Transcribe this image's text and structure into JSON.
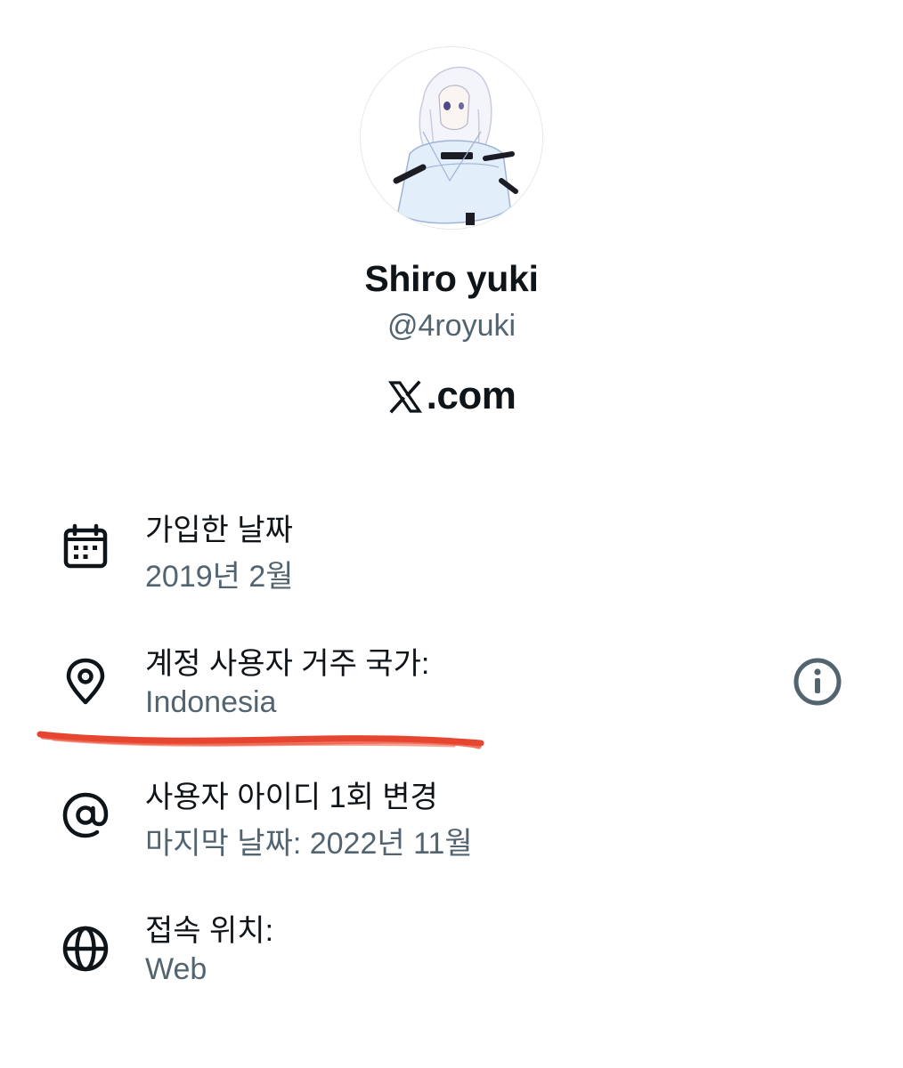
{
  "profile": {
    "display_name": "Shiro yuki",
    "handle": "@4royuki",
    "brand": ".com"
  },
  "about": {
    "joined": {
      "icon": "calendar-icon",
      "title": "가입한 날짜",
      "value": "2019년 2월"
    },
    "country": {
      "icon": "location-pin-icon",
      "title": "계정 사용자 거주 국가:",
      "value": "Indonesia",
      "info_icon": "info-circle-icon"
    },
    "username_change": {
      "icon": "at-sign-icon",
      "title": "사용자 아이디 1회 변경",
      "value": "마지막 날짜: 2022년 11월"
    },
    "connected_via": {
      "icon": "globe-icon",
      "title": "접속 위치:",
      "value": "Web"
    }
  },
  "colors": {
    "primary_text": "#0f1419",
    "secondary_text": "#536471",
    "annotation": "#e2321c"
  }
}
